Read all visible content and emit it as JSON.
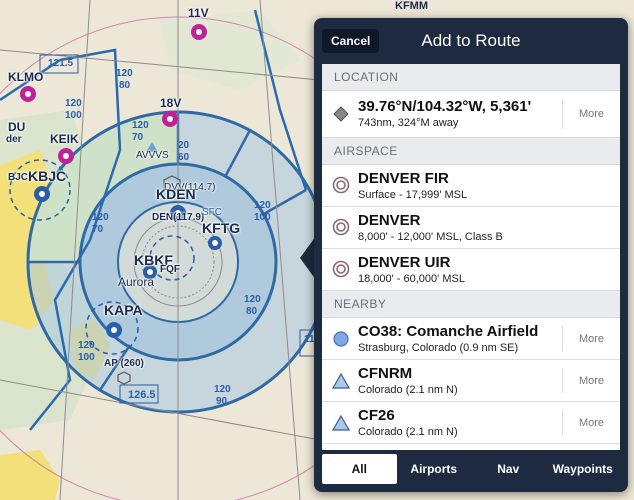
{
  "map": {
    "labels": {
      "kfmm": "KFMM",
      "v11": "11V",
      "v18": "18V",
      "klmo": "KLMO",
      "du": "DU",
      "der": "der",
      "keik": "KEIK",
      "bjc": "BJC",
      "kbjc": "KBJC",
      "avvvs": "AVVVS",
      "dvv": "DVV(114.7)",
      "kden": "KDEN",
      "den": "DEN(117.9)",
      "sfc": "SFC",
      "kftg": "KFTG",
      "kbkf": "KBKF",
      "fqf": "FQF",
      "aurora": "Aurora",
      "kapa": "KAPA",
      "ap": "AP (260)",
      "n1215": "121.5",
      "n1265": "126.5",
      "n80": "80",
      "n20": "20",
      "r120": "120",
      "r100": "100",
      "r70": "70",
      "r60": "60",
      "r90": "90",
      "r11": "11"
    }
  },
  "panel": {
    "cancel_label": "Cancel",
    "title": "Add to Route",
    "sections": {
      "location": "LOCATION",
      "airspace": "AIRSPACE",
      "nearby": "NEARBY"
    },
    "location": {
      "title": "39.76°N/104.32°W, 5,361'",
      "sub": "743nm, 324°M away",
      "more": "More"
    },
    "airspace": [
      {
        "title": "DENVER FIR",
        "sub": "Surface - 17,999' MSL"
      },
      {
        "title": "DENVER",
        "sub": "8,000' - 12,000' MSL, Class B"
      },
      {
        "title": "DENVER UIR",
        "sub": "18,000' - 60,000' MSL"
      }
    ],
    "nearby": [
      {
        "title": "CO38: Comanche Airfield",
        "sub": "Strasburg, Colorado  (0.9 nm SE)",
        "more": "More",
        "icon": "airport-circle-icon"
      },
      {
        "title": "CFNRM",
        "sub": "Colorado  (2.1 nm N)",
        "more": "More",
        "icon": "waypoint-triangle-icon"
      },
      {
        "title": "CF26",
        "sub": "Colorado  (2.1 nm N)",
        "more": "More",
        "icon": "waypoint-triangle-icon"
      }
    ],
    "tabs": [
      "All",
      "Airports",
      "Nav",
      "Waypoints"
    ],
    "active_tab": "All"
  },
  "colors": {
    "panel_bg": "#1d2a3f",
    "airspace_blue": "#4a7fb5",
    "class_b_fill": "#8fb9da",
    "airport_magenta": "#c0209a",
    "airport_blue": "#2a5ea8",
    "city_yellow": "#f4e27a",
    "terrain_green": "#cfe1c8"
  }
}
